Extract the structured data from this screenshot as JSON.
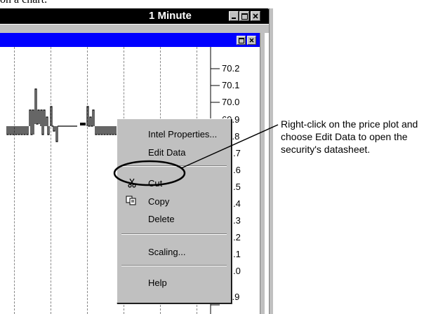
{
  "top_caption": "on a chart.",
  "window": {
    "title": "1 Minute"
  },
  "price_axis": {
    "ticks": [
      "70.2",
      "70.1",
      "70.0",
      "69.9",
      "69.8",
      ".7",
      ".6",
      ".5",
      ".4",
      ".3",
      ".2",
      ".1",
      ".0",
      "68.9"
    ]
  },
  "context_menu": {
    "items": [
      {
        "label": "Intel Properties..."
      },
      {
        "label": "Edit Data"
      },
      {
        "label": "Cut",
        "icon": "scissors-icon"
      },
      {
        "label": "Copy",
        "icon": "copy-icon"
      },
      {
        "label": "Delete"
      },
      {
        "label": "Scaling..."
      },
      {
        "label": "Help"
      }
    ]
  },
  "callout": {
    "text": "Right-click on the price plot and choose Edit Data to open the security's datasheet."
  }
}
